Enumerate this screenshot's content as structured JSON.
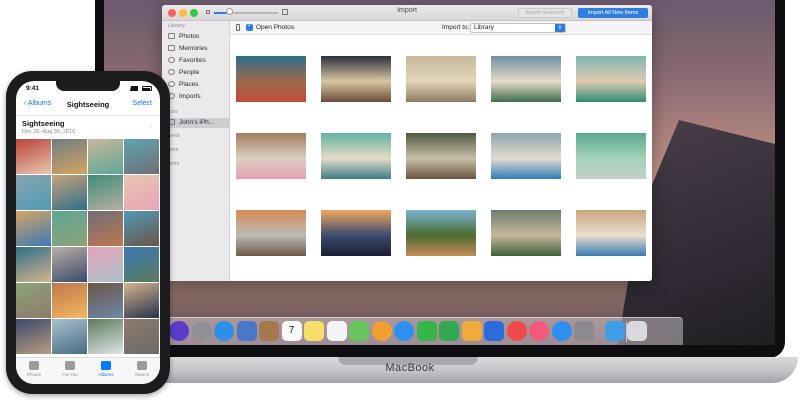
{
  "macbook": {
    "brand": "MacBook"
  },
  "window": {
    "title": "Import",
    "import_selected_label": "Import Selected",
    "import_all_label": "Import All New Items",
    "open_photos_label": "Open Photos",
    "open_photos_checked": true,
    "import_to_label": "Import to:",
    "import_to_value": "Library"
  },
  "sidebar": {
    "library_header": "Library",
    "items": [
      {
        "label": "Photos",
        "icon": "photos-icon"
      },
      {
        "label": "Memories",
        "icon": "memories-icon"
      },
      {
        "label": "Favorites",
        "icon": "heart-icon"
      },
      {
        "label": "People",
        "icon": "people-icon"
      },
      {
        "label": "Places",
        "icon": "pin-icon"
      },
      {
        "label": "Imports",
        "icon": "clock-icon"
      }
    ],
    "devices_header": "ices",
    "device": "John's iPh...",
    "shared_header": "ared",
    "albums_header": "ums",
    "projects_header": "jects"
  },
  "photo_colors": [
    [
      "#2b6d8a",
      "#9c6b4a",
      "#c24b3a"
    ],
    [
      "#2a2f3c",
      "#d7c6a2",
      "#6c4b3a"
    ],
    [
      "#c9b79a",
      "#e3d6bb",
      "#8d7a62"
    ],
    [
      "#6f8fa6",
      "#e7dcc4",
      "#3f6e4e"
    ],
    [
      "#7eb6b1",
      "#e0c9b0",
      "#2f8d73"
    ],
    [
      "#a47b5c",
      "#d9cfc0",
      "#e6a1b4"
    ],
    [
      "#5fb3a1",
      "#e8dcc6",
      "#3b7d86"
    ],
    [
      "#4d5a3e",
      "#c9bfa9",
      "#6b5643"
    ],
    [
      "#8ba6ae",
      "#e3dbcf",
      "#2c7fb8"
    ],
    [
      "#5aa88d",
      "#a3d3b8",
      "#c4cfc9"
    ],
    [
      "#d58b55",
      "#bdbab5",
      "#6e5b4a"
    ],
    [
      "#f0a95f",
      "#3b4b6f",
      "#1a2033"
    ],
    [
      "#7bb3d4",
      "#4c6b2f",
      "#c48a5a"
    ],
    [
      "#6d7e6b",
      "#c7b79d",
      "#3e5f3c"
    ],
    [
      "#caa57d",
      "#e9dfcf",
      "#3b7bb0"
    ],
    [
      "#dcd6cc",
      "#9f8e7b",
      "#6d6a63"
    ]
  ],
  "dock_icons": [
    {
      "name": "siri-icon",
      "color": "#5a3dc8"
    },
    {
      "name": "launchpad-icon",
      "color": "#8f8f96"
    },
    {
      "name": "safari-icon",
      "color": "#2f8fe6"
    },
    {
      "name": "mail-stamp-icon",
      "color": "#4a78c4"
    },
    {
      "name": "contacts-icon",
      "color": "#a5784d"
    },
    {
      "name": "calendar-icon",
      "color": "#fbfbfb"
    },
    {
      "name": "notes-icon",
      "color": "#f7dd6a"
    },
    {
      "name": "reminders-icon",
      "color": "#f4f4f4"
    },
    {
      "name": "maps-icon",
      "color": "#6bc35e"
    },
    {
      "name": "photos-app-icon",
      "color": "#f0a030"
    },
    {
      "name": "messages-icon",
      "color": "#2f8ff0"
    },
    {
      "name": "facetime-icon",
      "color": "#36b54a"
    },
    {
      "name": "numbers-icon",
      "color": "#33a852"
    },
    {
      "name": "pages-icon",
      "color": "#f1ab3b"
    },
    {
      "name": "keynote-icon",
      "color": "#2c6bd9"
    },
    {
      "name": "news-icon",
      "color": "#f24a4a"
    },
    {
      "name": "music-icon",
      "color": "#f25a7a"
    },
    {
      "name": "app-store-icon",
      "color": "#2f8ff0"
    },
    {
      "name": "system-prefs-icon",
      "color": "#8a8a8f"
    },
    {
      "name": "downloads-folder-icon",
      "color": "#3f9de8"
    },
    {
      "name": "trash-icon",
      "color": "#d8d9dc"
    }
  ],
  "dock_labels": {
    "calendar_day": "7"
  },
  "iphone": {
    "time": "9:41",
    "back_label": "Albums",
    "title": "Sightseeing",
    "select_label": "Select",
    "album_title": "Sightseeing",
    "album_date": "Dec 26–Aug 26, 2016",
    "tabs": [
      {
        "label": "Photos",
        "active": false
      },
      {
        "label": "For You",
        "active": false
      },
      {
        "label": "Albums",
        "active": true
      },
      {
        "label": "Search",
        "active": false
      }
    ],
    "grid_colors": [
      "#b9443a",
      "#6e7d86",
      "#c9b79c",
      "#5ea4b0",
      "#8aa3ae",
      "#c7a37b",
      "#3d8c78",
      "#e8c6b0",
      "#d7a460",
      "#5ea693",
      "#6f6f78",
      "#4f9bb8",
      "#2f6f8a",
      "#b8b0a2",
      "#e9a3b7",
      "#3a79b8",
      "#8ca27a",
      "#c0764d",
      "#6b5447",
      "#d4b48c",
      "#3b4a6d",
      "#a8c1cf",
      "#5c7b5c",
      "#8f7a6a",
      "#f4b860",
      "#6e89a7",
      "#27324f",
      "#b89d7c",
      "#4a6b82",
      "#dfe4e8",
      "#6b6b6b",
      "#2e4a7a"
    ]
  }
}
